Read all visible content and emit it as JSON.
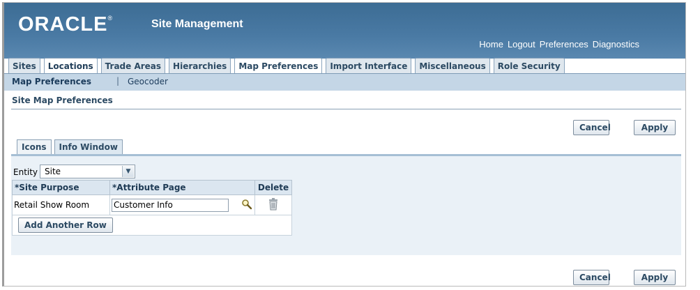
{
  "header": {
    "logo_text": "ORACLE",
    "logo_mark": "®",
    "app_title": "Site Management",
    "global_links": [
      "Home",
      "Logout",
      "Preferences",
      "Diagnostics"
    ]
  },
  "tabs": [
    {
      "label": "Sites"
    },
    {
      "label": "Locations"
    },
    {
      "label": "Trade Areas"
    },
    {
      "label": "Hierarchies"
    },
    {
      "label": "Map Preferences",
      "selected": true
    },
    {
      "label": "Import Interface"
    },
    {
      "label": "Miscellaneous"
    },
    {
      "label": "Role Security"
    }
  ],
  "subnav": {
    "selected": "Map Preferences",
    "separator": "|",
    "other": "Geocoder"
  },
  "page": {
    "title": "Site Map Preferences",
    "cancel_label": "Cancel",
    "apply_label": "Apply"
  },
  "subtabs": [
    {
      "label": "Icons"
    },
    {
      "label": "Info Window",
      "selected": true
    }
  ],
  "entity": {
    "label": "Entity",
    "value": "Site"
  },
  "table": {
    "columns": [
      "*Site Purpose",
      "*Attribute Page",
      "Delete"
    ],
    "rows": [
      {
        "site_purpose": "Retail Show Room",
        "attribute_page": "Customer Info"
      }
    ],
    "add_row_label": "Add Another Row"
  },
  "colors": {
    "header_blue": "#4a7aa4",
    "subnav_blue": "#c4d6e6",
    "panel_blue": "#eaf1f7"
  },
  "icons": {
    "search": "search-icon",
    "delete": "trash-icon",
    "dropdown": "chevron-down-icon"
  }
}
